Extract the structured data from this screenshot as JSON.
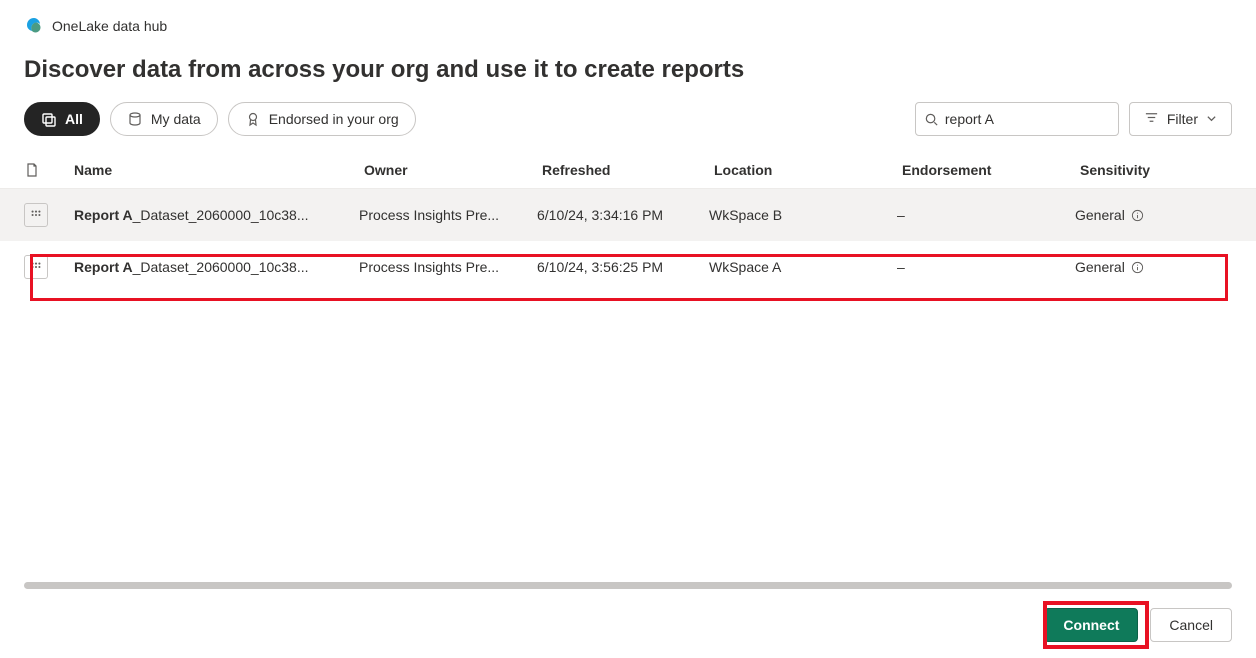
{
  "header": {
    "hub_title": "OneLake data hub"
  },
  "page": {
    "heading": "Discover data from across your org and use it to create reports"
  },
  "tabs": {
    "all": "All",
    "mydata": "My data",
    "endorsed": "Endorsed in your org"
  },
  "search": {
    "value": "report A"
  },
  "filter_label": "Filter",
  "columns": {
    "name": "Name",
    "owner": "Owner",
    "refreshed": "Refreshed",
    "location": "Location",
    "endorsement": "Endorsement",
    "sensitivity": "Sensitivity"
  },
  "rows": [
    {
      "name_bold": "Report A",
      "name_rest": "_Dataset_2060000_10c38...",
      "owner": "Process Insights Pre...",
      "refreshed": "6/10/24, 3:34:16 PM",
      "location": "WkSpace B",
      "endorsement": "–",
      "sensitivity": "General"
    },
    {
      "name_bold": "Report A",
      "name_rest": "_Dataset_2060000_10c38...",
      "owner": "Process Insights Pre...",
      "refreshed": "6/10/24, 3:56:25 PM",
      "location": "WkSpace A",
      "endorsement": "–",
      "sensitivity": "General"
    }
  ],
  "footer": {
    "connect": "Connect",
    "cancel": "Cancel"
  }
}
